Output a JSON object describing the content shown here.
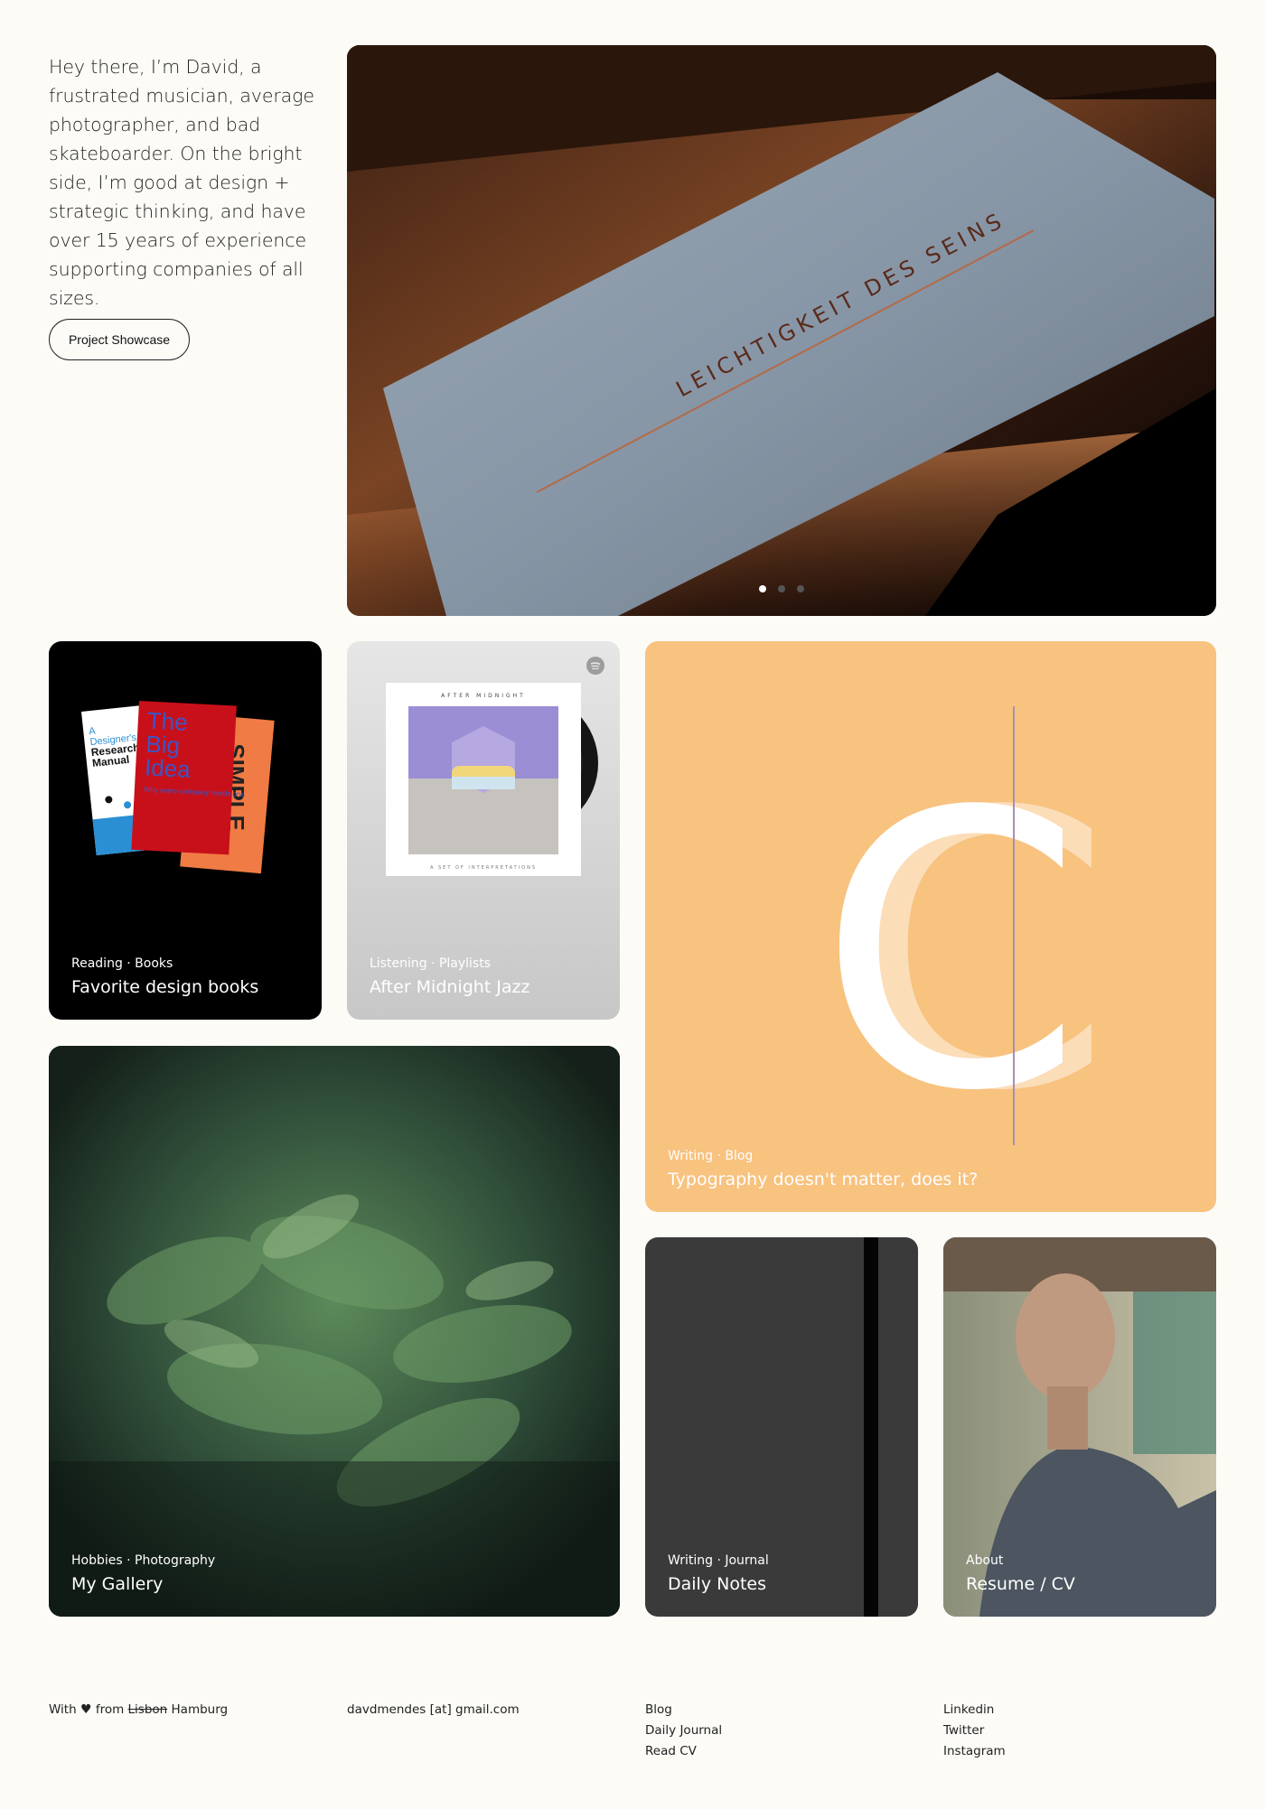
{
  "intro": {
    "text": "Hey there, I’m David, a frustrated musician, average photographer, and bad skateboarder. On the bright side, I’m good at design + strategic thinking, and have over 15 years of experience supporting companies of all sizes.",
    "button_label": "Project Showcase"
  },
  "hero": {
    "label_text": "LEICHTIGKEIT DES SEINS",
    "slides": 3,
    "active_slide": 1
  },
  "cards": {
    "books": {
      "kicker": "Reading · Books",
      "title": "Favorite design books",
      "cover1": [
        "A",
        "Designer's",
        "Research",
        "Manual"
      ],
      "cover2": [
        "The",
        "Big",
        "Idea"
      ],
      "cover2_sub": "Why every company needs one",
      "cover3": "SIMPLE"
    },
    "jazz": {
      "kicker": "Listening · Playlists",
      "title": "After Midnight Jazz",
      "album_top": "AFTER MIDNIGHT",
      "album_bottom": "A SET OF INTERPRETATIONS"
    },
    "typo": {
      "kicker": "Writing · Blog",
      "title": "Typography doesn't matter, does it?",
      "glyph": "C"
    },
    "gallery": {
      "kicker": "Hobbies · Photography",
      "title": "My Gallery"
    },
    "notes": {
      "kicker": "Writing · Journal",
      "title": "Daily Notes"
    },
    "about": {
      "kicker": "About",
      "title": "Resume / CV"
    }
  },
  "footer": {
    "with": "With",
    "from": "from",
    "struck_city": "Lisbon",
    "city": "Hamburg",
    "email": "davdmendes [at] gmail.com",
    "links_a": [
      "Blog",
      "Daily Journal",
      "Read CV"
    ],
    "links_b": [
      "Linkedin",
      "Twitter",
      "Instagram"
    ]
  },
  "colors": {
    "background": "#fcfbf6",
    "typo_card": "#f8c27f",
    "notes_card": "#3a3a3a"
  }
}
